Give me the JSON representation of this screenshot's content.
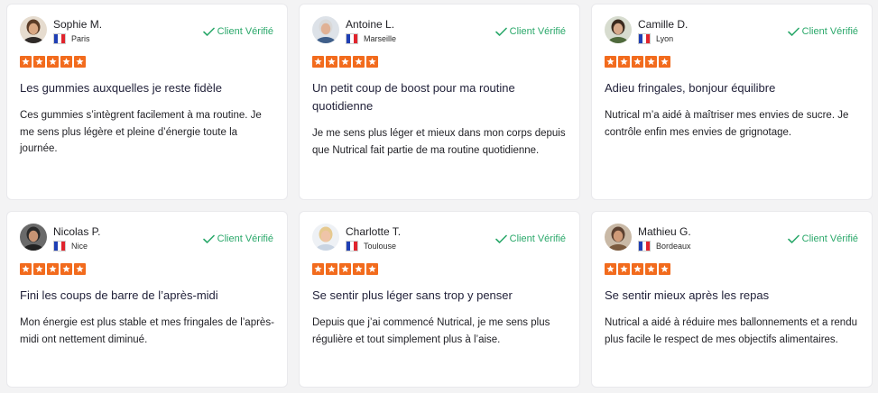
{
  "reviews": [
    {
      "name": "Sophie M.",
      "city": "Paris",
      "verified_label": "Client Vérifié",
      "rating": 5,
      "title": "Les gummies auxquelles je reste fidèle",
      "text": "Ces gummies s’intègrent facilement à ma routine. Je me sens plus légère et pleine d’énergie toute la journée."
    },
    {
      "name": "Antoine L.",
      "city": "Marseille",
      "verified_label": "Client Vérifié",
      "rating": 5,
      "title": "Un petit coup de boost pour ma routine quotidienne",
      "text": "Je me sens plus léger et mieux dans mon corps depuis que Nutrical fait partie de ma routine quotidienne."
    },
    {
      "name": "Camille D.",
      "city": "Lyon",
      "verified_label": "Client Vérifié",
      "rating": 5,
      "title": "Adieu fringales, bonjour équilibre",
      "text": "Nutrical m’a aidé à maîtriser mes envies de sucre. Je contrôle enfin mes envies de grignotage."
    },
    {
      "name": "Nicolas P.",
      "city": "Nice",
      "verified_label": "Client Vérifié",
      "rating": 5,
      "title": "Fini les coups de barre de l’après-midi",
      "text": "Mon énergie est plus stable et mes fringales de l’après-midi ont nettement diminué."
    },
    {
      "name": "Charlotte T.",
      "city": "Toulouse",
      "verified_label": "Client Vérifié",
      "rating": 5,
      "title": "Se sentir plus léger sans trop y penser",
      "text": "Depuis que j’ai commencé Nutrical, je me sens plus régulière et tout simplement plus à l’aise."
    },
    {
      "name": "Mathieu G.",
      "city": "Bordeaux",
      "verified_label": "Client Vérifié",
      "rating": 5,
      "title": "Se sentir mieux après les repas",
      "text": "Nutrical a aidé à réduire mes ballonnements et a rendu plus facile le respect de mes objectifs alimentaires."
    }
  ],
  "colors": {
    "star": "#f26b1d",
    "verified": "#2aa86a",
    "card_bg": "#ffffff",
    "page_bg": "#f3f3f4"
  },
  "icons": {
    "verified": "check-icon",
    "rating": "star-icon",
    "flag": "france-flag-icon"
  }
}
